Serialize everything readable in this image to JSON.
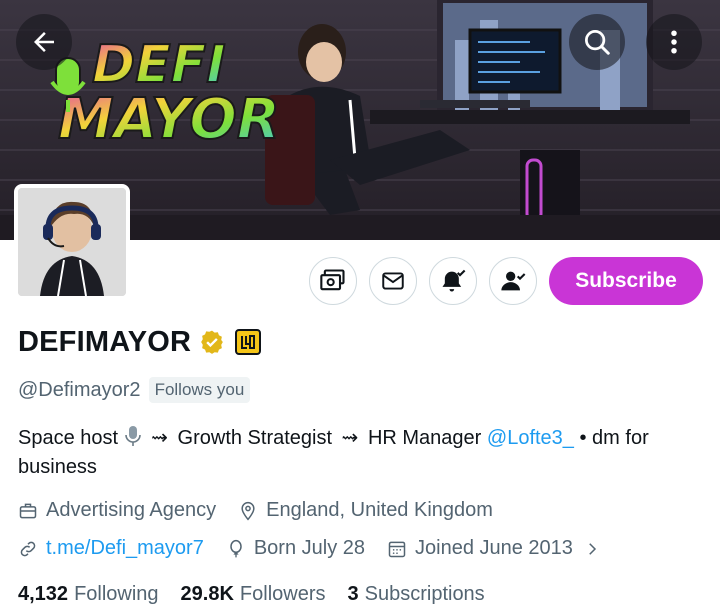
{
  "banner": {
    "logo_text_line1": "DEFI",
    "logo_text_line2": "MAYOR",
    "colors": {
      "neon_pink": "#e64aa8",
      "neon_green": "#7ee03a",
      "neon_yellow": "#f2d33a",
      "room": "#2e2a33"
    }
  },
  "topbar": {
    "back_icon": "arrow-left-icon",
    "search_icon": "search-icon",
    "more_icon": "more-vertical-icon"
  },
  "profile": {
    "display_name": "DEFIMAYOR",
    "verified_color": "#e2b719",
    "handle": "@Defimayor2",
    "follows_you": "Follows you",
    "bio": {
      "part1": "Space host",
      "part2": "Growth Strategist",
      "part3": "HR Manager",
      "mention": "@Lofte3_",
      "part4": "• dm for business"
    },
    "category": "Advertising Agency",
    "location": "England, United Kingdom",
    "link": "t.me/Defi_mayor7",
    "born": "Born July 28",
    "joined": "Joined June 2013"
  },
  "actions": {
    "subscribe_label": "Subscribe",
    "subscribe_color": "#c935d6",
    "icons": [
      "money-icon",
      "mail-icon",
      "bell-check-icon",
      "follow-check-icon"
    ]
  },
  "stats": {
    "following_count": "4,132",
    "following_label": "Following",
    "followers_count": "29.8K",
    "followers_label": "Followers",
    "subscriptions_count": "3",
    "subscriptions_label": "Subscriptions"
  }
}
